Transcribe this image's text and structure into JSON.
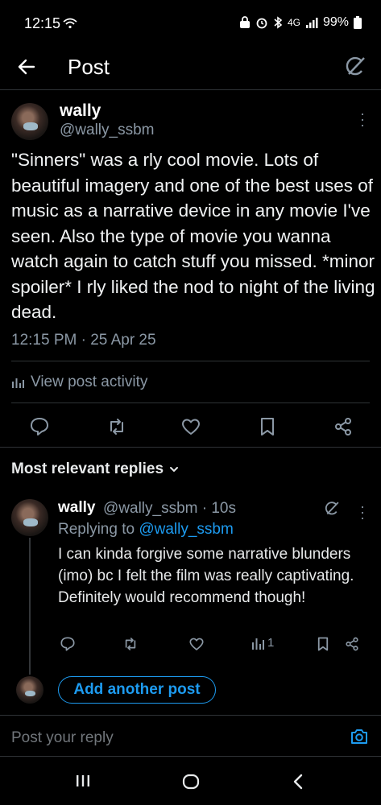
{
  "status_bar": {
    "time": "12:15",
    "network": "4G",
    "battery": "99%"
  },
  "header": {
    "title": "Post"
  },
  "post": {
    "author_name": "wally",
    "author_handle": "@wally_ssbm",
    "text": "\"Sinners\" was a rly cool movie. Lots of beautiful imagery and one of the best uses of music as a narrative device in any movie I've seen. Also the type of movie you wanna watch again to catch stuff you missed. *minor spoiler* I rly liked the nod to night of the living dead.",
    "timestamp": "12:15 PM · 25 Apr 25",
    "activity_label": "View post activity"
  },
  "replies_section": {
    "title": "Most relevant replies"
  },
  "reply": {
    "author_name": "wally",
    "meta": "@wally_ssbm · 10s",
    "replying_prefix": "Replying to",
    "replying_handle": "@wally_ssbm",
    "text": "I can kinda forgive some narrative blunders (imo) bc I felt the film was really captivating. Definitely would recommend though!",
    "views": "1"
  },
  "add_post": {
    "label": "Add another post"
  },
  "compose": {
    "placeholder": "Post your reply"
  },
  "colors": {
    "accent": "#1d9bf0",
    "background": "#000000",
    "muted": "#8b98a5"
  },
  "icons": [
    "back-arrow-icon",
    "grok-icon",
    "reply-icon",
    "repost-icon",
    "like-icon",
    "bookmark-icon",
    "share-icon",
    "analytics-icon",
    "camera-icon",
    "more-icon",
    "chevron-down-icon"
  ]
}
